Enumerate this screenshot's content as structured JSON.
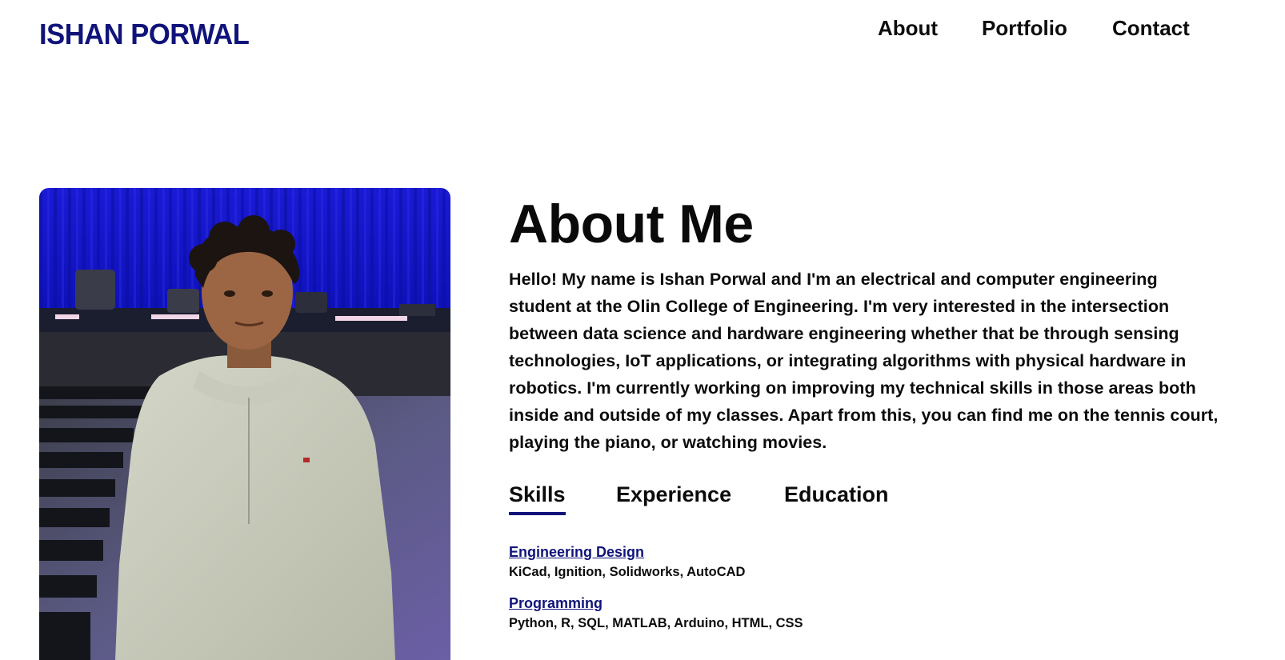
{
  "brand": {
    "name": "ISHAN PORWAL",
    "color": "#10147a"
  },
  "nav": {
    "items": [
      "About",
      "Portfolio",
      "Contact"
    ]
  },
  "about": {
    "title": "About Me",
    "bio": "Hello! My name is Ishan Porwal and I'm an electrical and computer engineering student at the Olin College of Engineering. I'm very interested in the intersection between data science and hardware engineering whether that be through sensing technologies, IoT applications, or integrating algorithms with physical hardware in robotics. I'm currently working on improving my technical skills in those areas both inside and outside of my classes. Apart from this, you can find me on the tennis court, playing the piano, or watching movies."
  },
  "tabs": {
    "items": [
      "Skills",
      "Experience",
      "Education"
    ],
    "active": "Skills"
  },
  "skills": [
    {
      "title": "Engineering Design",
      "items": "KiCad, Ignition, Solidworks, AutoCAD"
    },
    {
      "title": "Programming",
      "items": "Python, R, SQL, MATLAB, Arduino, HTML, CSS"
    }
  ]
}
